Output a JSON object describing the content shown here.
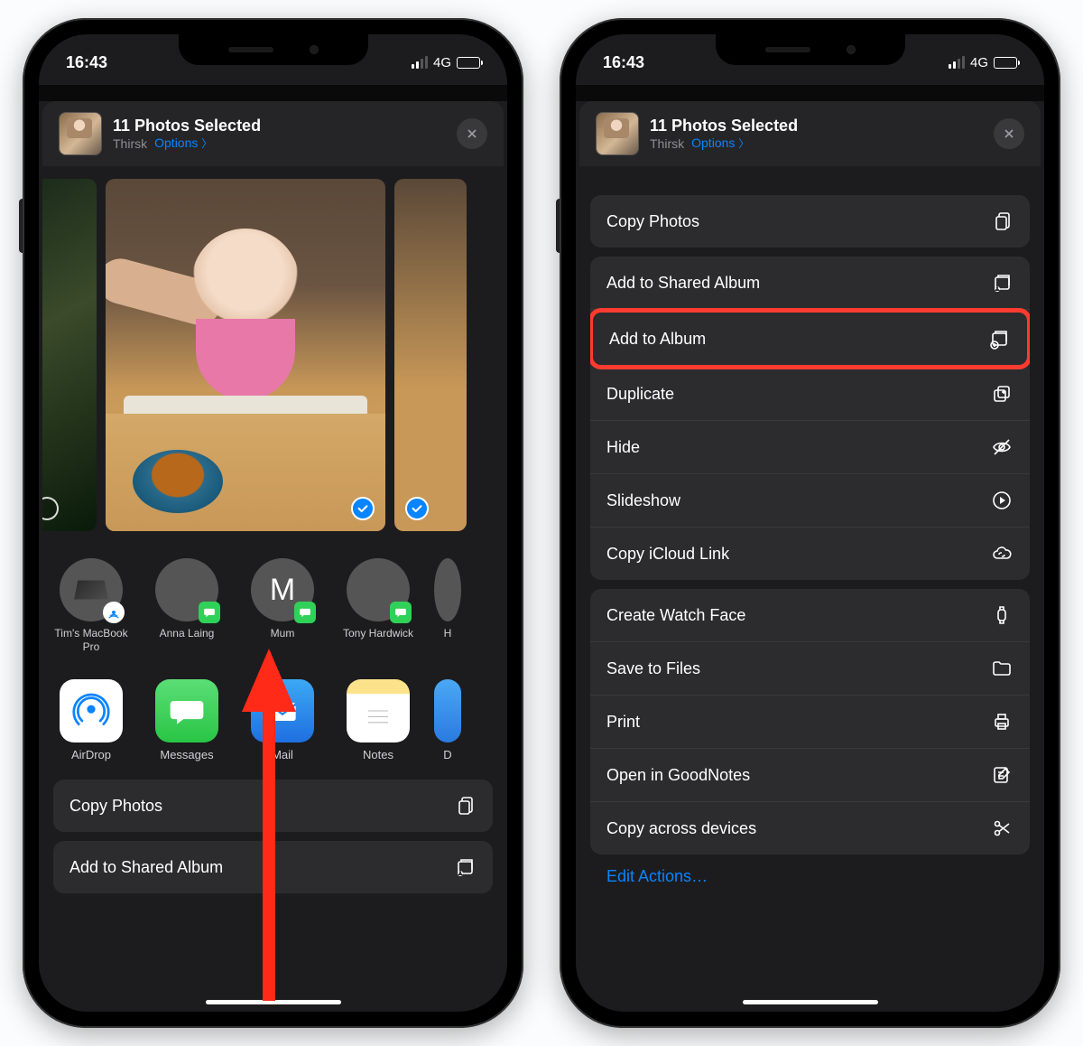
{
  "status": {
    "time": "16:43",
    "network": "4G"
  },
  "header": {
    "title": "11 Photos Selected",
    "location": "Thirsk",
    "options_label": "Options"
  },
  "contacts": [
    {
      "name": "Tim's MacBook Pro",
      "avatar": "macbook",
      "badge": "airdrop"
    },
    {
      "name": "Anna Laing",
      "avatar": "anna",
      "badge": "msg"
    },
    {
      "name": "Mum",
      "avatar": "initial",
      "initial": "M",
      "badge": "msg"
    },
    {
      "name": "Tony Hardwick",
      "avatar": "tony",
      "badge": "msg"
    },
    {
      "name": "H",
      "avatar": "cut",
      "badge": ""
    }
  ],
  "apps": [
    {
      "name": "AirDrop",
      "icon": "airdrop"
    },
    {
      "name": "Messages",
      "icon": "messages"
    },
    {
      "name": "Mail",
      "icon": "mail"
    },
    {
      "name": "Notes",
      "icon": "notes"
    },
    {
      "name": "D",
      "icon": "cut"
    }
  ],
  "left_actions": {
    "copy": "Copy Photos",
    "shared": "Add to Shared Album"
  },
  "right_actions": {
    "group1": [
      {
        "label": "Copy Photos",
        "icon": "copy"
      }
    ],
    "group2": [
      {
        "label": "Add to Shared Album",
        "icon": "shared-album"
      },
      {
        "label": "Add to Album",
        "icon": "album",
        "highlight": true
      },
      {
        "label": "Duplicate",
        "icon": "duplicate"
      },
      {
        "label": "Hide",
        "icon": "hide"
      },
      {
        "label": "Slideshow",
        "icon": "play"
      },
      {
        "label": "Copy iCloud Link",
        "icon": "link"
      }
    ],
    "group3": [
      {
        "label": "Create Watch Face",
        "icon": "watch"
      },
      {
        "label": "Save to Files",
        "icon": "folder"
      },
      {
        "label": "Print",
        "icon": "print"
      },
      {
        "label": "Open in GoodNotes",
        "icon": "note"
      },
      {
        "label": "Copy across devices",
        "icon": "scissors"
      }
    ],
    "edit": "Edit Actions…"
  }
}
